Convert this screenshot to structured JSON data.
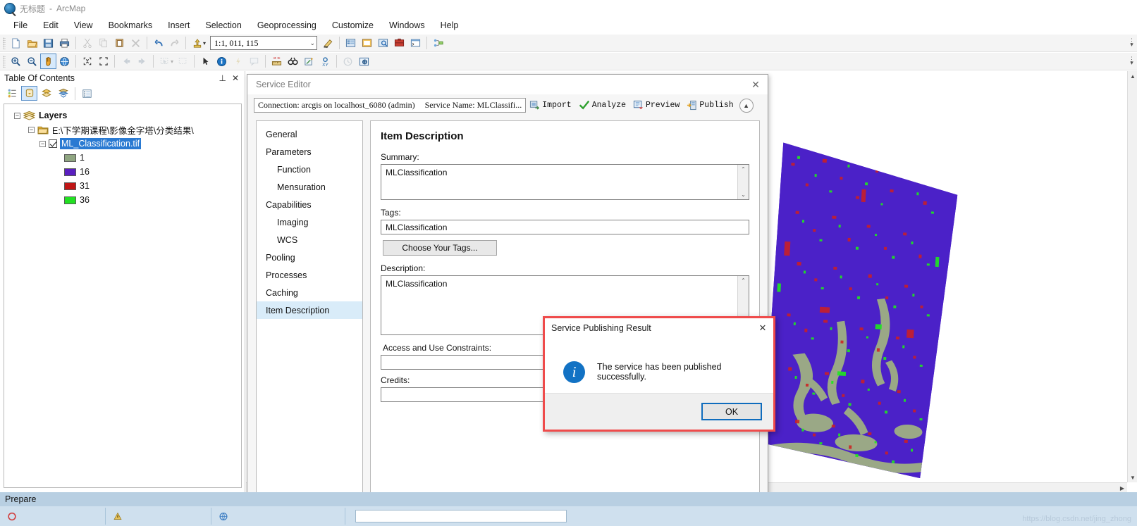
{
  "window": {
    "document_title": "无标题",
    "app_name": "ArcMap",
    "separator": "-"
  },
  "menu": {
    "items": [
      "File",
      "Edit",
      "View",
      "Bookmarks",
      "Insert",
      "Selection",
      "Geoprocessing",
      "Customize",
      "Windows",
      "Help"
    ]
  },
  "standard_toolbar": {
    "scale_value": "1:1, 011, 115",
    "icons": [
      "new-document-icon",
      "open-folder-icon",
      "save-icon",
      "print-icon",
      "cut-icon",
      "copy-icon",
      "paste-icon",
      "delete-icon",
      "undo-icon",
      "redo-icon",
      "add-data-icon",
      "editor-toolbar-icon",
      "table-of-contents-icon",
      "catalog-window-icon",
      "search-window-icon",
      "arctoolbox-icon",
      "python-window-icon",
      "modelbuilder-icon"
    ]
  },
  "tools_toolbar": {
    "icons": [
      "zoom-in-icon",
      "zoom-out-icon",
      "pan-icon",
      "full-extent-icon",
      "fixed-zoom-in-icon",
      "fixed-zoom-out-icon",
      "back-extent-icon",
      "forward-extent-icon",
      "select-features-icon",
      "clear-selection-icon",
      "select-elements-icon",
      "identify-icon",
      "hyperlink-icon",
      "html-popup-icon",
      "measure-icon",
      "find-icon",
      "find-route-icon",
      "go-to-xy-icon",
      "time-slider-icon",
      "create-viewer-window-icon"
    ],
    "active_tool": "pan-icon"
  },
  "table_of_contents": {
    "title": "Table Of Contents",
    "pin_icon": "pin-icon",
    "close_icon": "close-icon",
    "tools": [
      "list-by-drawing-order-icon",
      "list-by-source-icon",
      "list-by-visibility-icon",
      "list-by-selection-icon",
      "options-icon"
    ],
    "active_tool_index": 1,
    "tree": {
      "root_label": "Layers",
      "folder_label": "E:\\下学期课程\\影像金字塔\\分类结果\\",
      "layer_label": "ML_Classification.tif",
      "layer_checked": true,
      "legend": [
        {
          "value": "1",
          "color": "#8fa581"
        },
        {
          "value": "16",
          "color": "#5a1fc0"
        },
        {
          "value": "31",
          "color": "#c01616"
        },
        {
          "value": "36",
          "color": "#22e022"
        }
      ]
    }
  },
  "service_editor": {
    "title": "Service Editor",
    "close_icon": "close-icon",
    "connection_label": "Connection: arcgis on localhost_6080 (admin)",
    "service_name_label": "Service Name: MLClassifi...",
    "actions": [
      {
        "label": "Import",
        "icon": "import-icon"
      },
      {
        "label": "Analyze",
        "icon": "check-icon"
      },
      {
        "label": "Preview",
        "icon": "preview-icon"
      },
      {
        "label": "Publish",
        "icon": "publish-icon"
      }
    ],
    "collapse_icon": "chevron-up-icon",
    "nav": [
      {
        "label": "General",
        "sub": false,
        "active": false
      },
      {
        "label": "Parameters",
        "sub": false,
        "active": false
      },
      {
        "label": "Function",
        "sub": true,
        "active": false
      },
      {
        "label": "Mensuration",
        "sub": true,
        "active": false
      },
      {
        "label": "Capabilities",
        "sub": false,
        "active": false
      },
      {
        "label": "Imaging",
        "sub": true,
        "active": false
      },
      {
        "label": "WCS",
        "sub": true,
        "active": false
      },
      {
        "label": "Pooling",
        "sub": false,
        "active": false
      },
      {
        "label": "Processes",
        "sub": false,
        "active": false
      },
      {
        "label": "Caching",
        "sub": false,
        "active": false
      },
      {
        "label": "Item Description",
        "sub": false,
        "active": true
      }
    ],
    "panel": {
      "heading": "Item Description",
      "summary_label": "Summary:",
      "summary_value": "MLClassification",
      "tags_label": "Tags:",
      "tags_value": "MLClassification",
      "choose_tags_button": "Choose Your Tags...",
      "description_label": "Description:",
      "description_value": "MLClassification",
      "constraints_label": "Access and Use Constraints:",
      "constraints_value": "",
      "credits_label": "Credits:",
      "credits_value": ""
    }
  },
  "publish_dialog": {
    "title": "Service Publishing Result",
    "close_icon": "close-icon",
    "info_icon": "info-icon",
    "message": "The service has been published successfully.",
    "ok_button": "OK",
    "border_color": "#ef4b4b"
  },
  "status_bar": {
    "text": "Prepare"
  },
  "watermark": {
    "text": "https://blog.csdn.net/jing_zhong"
  }
}
